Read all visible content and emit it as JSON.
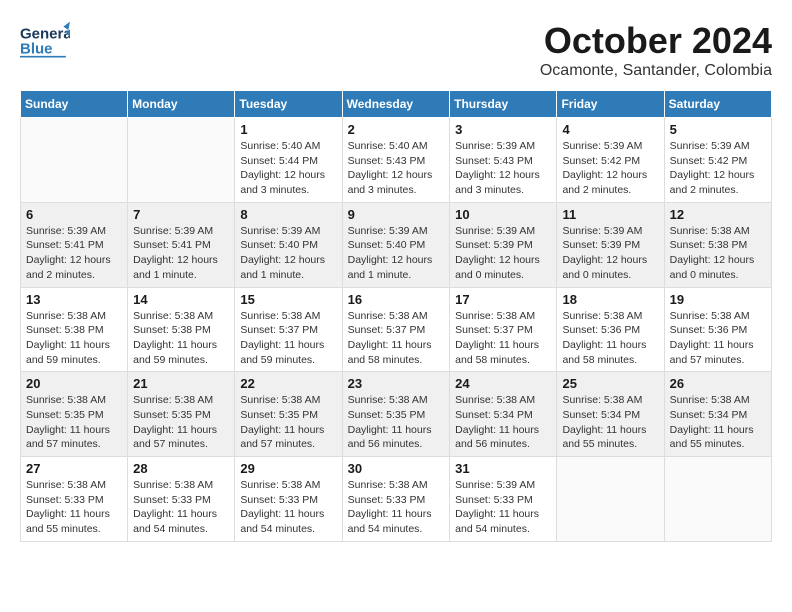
{
  "header": {
    "logo": {
      "line1": "General",
      "line2": "Blue"
    },
    "title": "October 2024",
    "location": "Ocamonte, Santander, Colombia"
  },
  "days_of_week": [
    "Sunday",
    "Monday",
    "Tuesday",
    "Wednesday",
    "Thursday",
    "Friday",
    "Saturday"
  ],
  "weeks": [
    [
      {
        "day": "",
        "info": ""
      },
      {
        "day": "",
        "info": ""
      },
      {
        "day": "1",
        "info": "Sunrise: 5:40 AM\nSunset: 5:44 PM\nDaylight: 12 hours and 3 minutes."
      },
      {
        "day": "2",
        "info": "Sunrise: 5:40 AM\nSunset: 5:43 PM\nDaylight: 12 hours and 3 minutes."
      },
      {
        "day": "3",
        "info": "Sunrise: 5:39 AM\nSunset: 5:43 PM\nDaylight: 12 hours and 3 minutes."
      },
      {
        "day": "4",
        "info": "Sunrise: 5:39 AM\nSunset: 5:42 PM\nDaylight: 12 hours and 2 minutes."
      },
      {
        "day": "5",
        "info": "Sunrise: 5:39 AM\nSunset: 5:42 PM\nDaylight: 12 hours and 2 minutes."
      }
    ],
    [
      {
        "day": "6",
        "info": "Sunrise: 5:39 AM\nSunset: 5:41 PM\nDaylight: 12 hours and 2 minutes."
      },
      {
        "day": "7",
        "info": "Sunrise: 5:39 AM\nSunset: 5:41 PM\nDaylight: 12 hours and 1 minute."
      },
      {
        "day": "8",
        "info": "Sunrise: 5:39 AM\nSunset: 5:40 PM\nDaylight: 12 hours and 1 minute."
      },
      {
        "day": "9",
        "info": "Sunrise: 5:39 AM\nSunset: 5:40 PM\nDaylight: 12 hours and 1 minute."
      },
      {
        "day": "10",
        "info": "Sunrise: 5:39 AM\nSunset: 5:39 PM\nDaylight: 12 hours and 0 minutes."
      },
      {
        "day": "11",
        "info": "Sunrise: 5:39 AM\nSunset: 5:39 PM\nDaylight: 12 hours and 0 minutes."
      },
      {
        "day": "12",
        "info": "Sunrise: 5:38 AM\nSunset: 5:38 PM\nDaylight: 12 hours and 0 minutes."
      }
    ],
    [
      {
        "day": "13",
        "info": "Sunrise: 5:38 AM\nSunset: 5:38 PM\nDaylight: 11 hours and 59 minutes."
      },
      {
        "day": "14",
        "info": "Sunrise: 5:38 AM\nSunset: 5:38 PM\nDaylight: 11 hours and 59 minutes."
      },
      {
        "day": "15",
        "info": "Sunrise: 5:38 AM\nSunset: 5:37 PM\nDaylight: 11 hours and 59 minutes."
      },
      {
        "day": "16",
        "info": "Sunrise: 5:38 AM\nSunset: 5:37 PM\nDaylight: 11 hours and 58 minutes."
      },
      {
        "day": "17",
        "info": "Sunrise: 5:38 AM\nSunset: 5:37 PM\nDaylight: 11 hours and 58 minutes."
      },
      {
        "day": "18",
        "info": "Sunrise: 5:38 AM\nSunset: 5:36 PM\nDaylight: 11 hours and 58 minutes."
      },
      {
        "day": "19",
        "info": "Sunrise: 5:38 AM\nSunset: 5:36 PM\nDaylight: 11 hours and 57 minutes."
      }
    ],
    [
      {
        "day": "20",
        "info": "Sunrise: 5:38 AM\nSunset: 5:35 PM\nDaylight: 11 hours and 57 minutes."
      },
      {
        "day": "21",
        "info": "Sunrise: 5:38 AM\nSunset: 5:35 PM\nDaylight: 11 hours and 57 minutes."
      },
      {
        "day": "22",
        "info": "Sunrise: 5:38 AM\nSunset: 5:35 PM\nDaylight: 11 hours and 57 minutes."
      },
      {
        "day": "23",
        "info": "Sunrise: 5:38 AM\nSunset: 5:35 PM\nDaylight: 11 hours and 56 minutes."
      },
      {
        "day": "24",
        "info": "Sunrise: 5:38 AM\nSunset: 5:34 PM\nDaylight: 11 hours and 56 minutes."
      },
      {
        "day": "25",
        "info": "Sunrise: 5:38 AM\nSunset: 5:34 PM\nDaylight: 11 hours and 55 minutes."
      },
      {
        "day": "26",
        "info": "Sunrise: 5:38 AM\nSunset: 5:34 PM\nDaylight: 11 hours and 55 minutes."
      }
    ],
    [
      {
        "day": "27",
        "info": "Sunrise: 5:38 AM\nSunset: 5:33 PM\nDaylight: 11 hours and 55 minutes."
      },
      {
        "day": "28",
        "info": "Sunrise: 5:38 AM\nSunset: 5:33 PM\nDaylight: 11 hours and 54 minutes."
      },
      {
        "day": "29",
        "info": "Sunrise: 5:38 AM\nSunset: 5:33 PM\nDaylight: 11 hours and 54 minutes."
      },
      {
        "day": "30",
        "info": "Sunrise: 5:38 AM\nSunset: 5:33 PM\nDaylight: 11 hours and 54 minutes."
      },
      {
        "day": "31",
        "info": "Sunrise: 5:39 AM\nSunset: 5:33 PM\nDaylight: 11 hours and 54 minutes."
      },
      {
        "day": "",
        "info": ""
      },
      {
        "day": "",
        "info": ""
      }
    ]
  ]
}
